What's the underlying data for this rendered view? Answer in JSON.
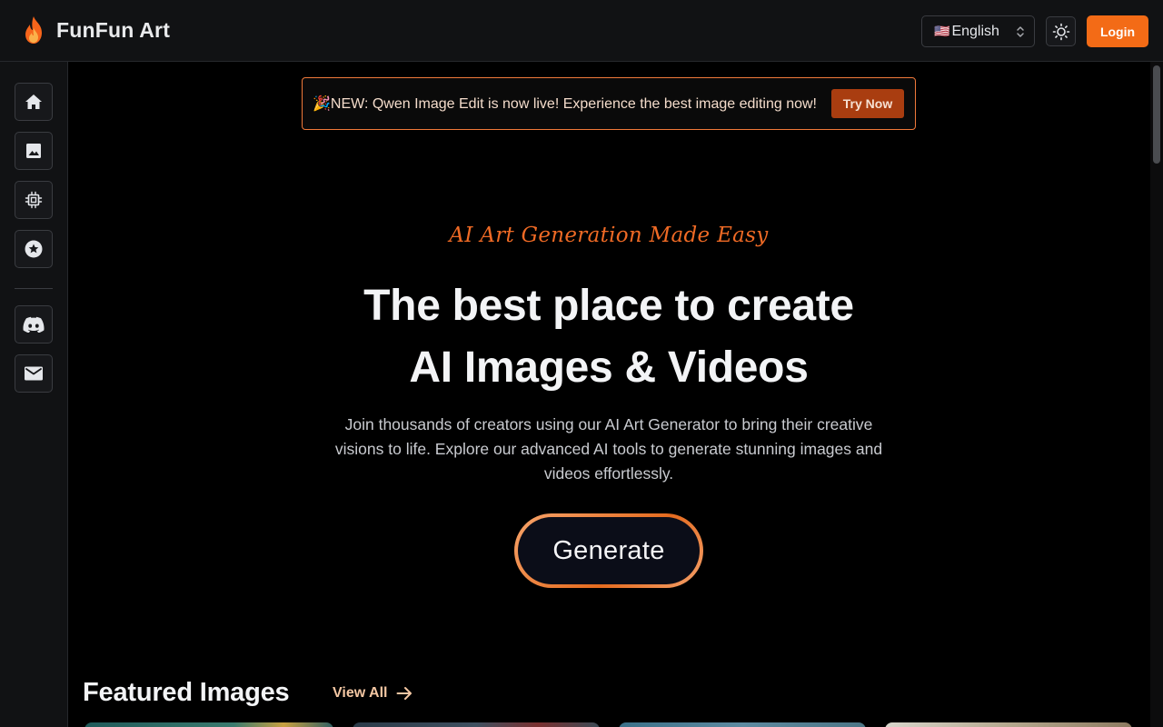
{
  "header": {
    "brand_name": "FunFun Art",
    "language_flag": "🇺🇸",
    "language_label": "English",
    "login_label": "Login"
  },
  "sidebar": {
    "items": [
      {
        "name": "home",
        "icon": "home-icon"
      },
      {
        "name": "images",
        "icon": "image-icon"
      },
      {
        "name": "models",
        "icon": "chip-icon"
      },
      {
        "name": "favorites",
        "icon": "star-icon"
      },
      {
        "name": "discord",
        "icon": "discord-icon"
      },
      {
        "name": "contact",
        "icon": "mail-icon"
      }
    ]
  },
  "announcement": {
    "emoji": "🎉",
    "text": "NEW: Qwen Image Edit is now live! Experience the best image editing now!",
    "cta_label": "Try Now"
  },
  "hero": {
    "tagline": "AI Art Generation Made Easy",
    "title_line1": "The best place to create",
    "title_line2": "AI Images & Videos",
    "subtitle": "Join thousands of creators using our AI Art Generator to bring their creative visions to life. Explore our advanced AI tools to generate stunning images and videos effortlessly.",
    "generate_label": "Generate"
  },
  "featured": {
    "title": "Featured Images",
    "view_all_label": "View All"
  },
  "colors": {
    "accent": "#f36b16",
    "announcement_border": "#f0793a",
    "try_now_bg": "#a93d10",
    "background": "#000000",
    "panel": "#111214"
  }
}
